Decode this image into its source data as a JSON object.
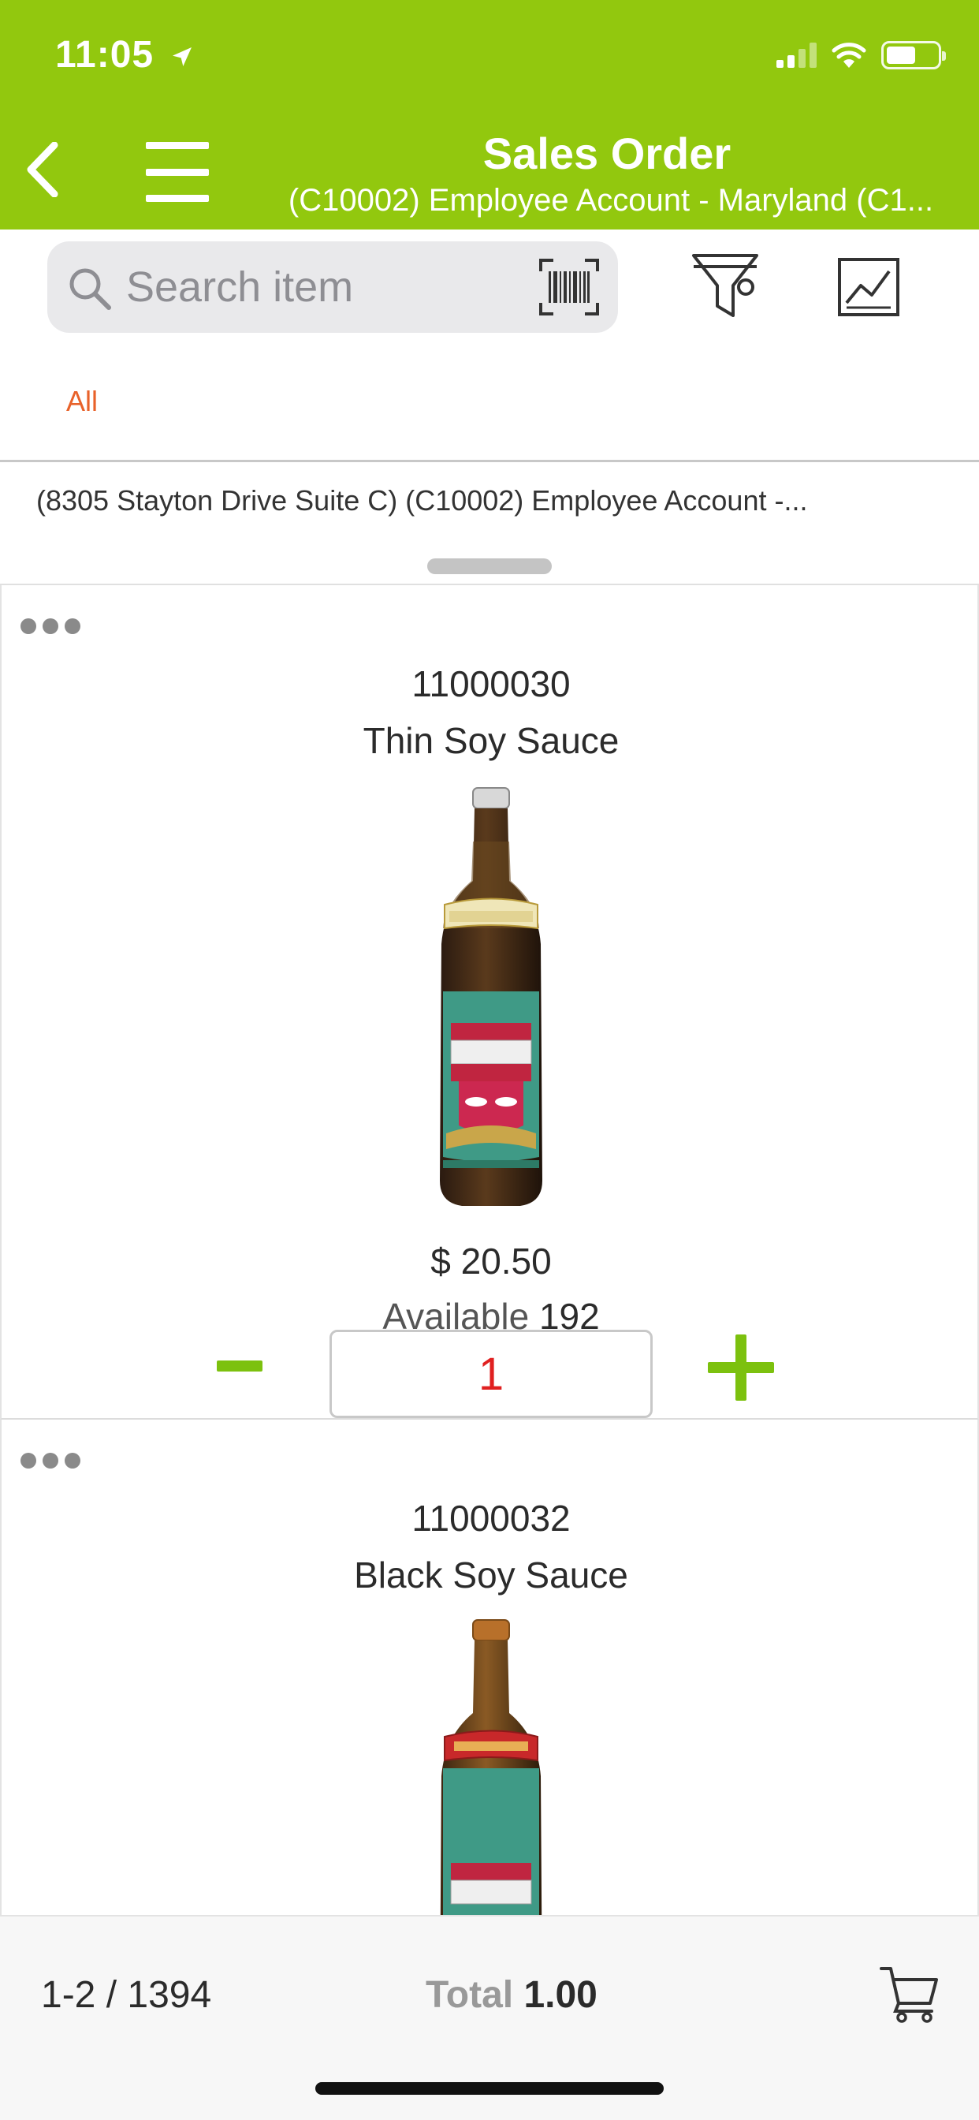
{
  "status_bar": {
    "time": "11:05"
  },
  "header": {
    "title": "Sales Order",
    "subtitle": "(C10002) Employee Account - Maryland (C1...",
    "background": "#92c80e"
  },
  "search": {
    "placeholder": "Search item"
  },
  "tabs": [
    {
      "label": "All",
      "active": true
    }
  ],
  "address": "(8305 Stayton Drive Suite C) (C10002) Employee Account -...",
  "items": [
    {
      "code": "11000030",
      "name": "Thin Soy Sauce",
      "price": "$ 20.50",
      "available_label": "Available",
      "available_count": "192",
      "quantity": "1"
    },
    {
      "code": "11000032",
      "name": "Black Soy Sauce"
    }
  ],
  "footer": {
    "range": "1-2 / 1394",
    "total_label": "Total",
    "total_value": "1.00"
  },
  "colors": {
    "accent": "#7cc10e",
    "tab_active": "#e8622a",
    "quantity_text": "#e02020"
  },
  "icons": [
    "back-icon",
    "menu-icon",
    "search-icon",
    "barcode-scan-icon",
    "filter-icon",
    "chart-icon",
    "more-icon",
    "cart-icon"
  ]
}
